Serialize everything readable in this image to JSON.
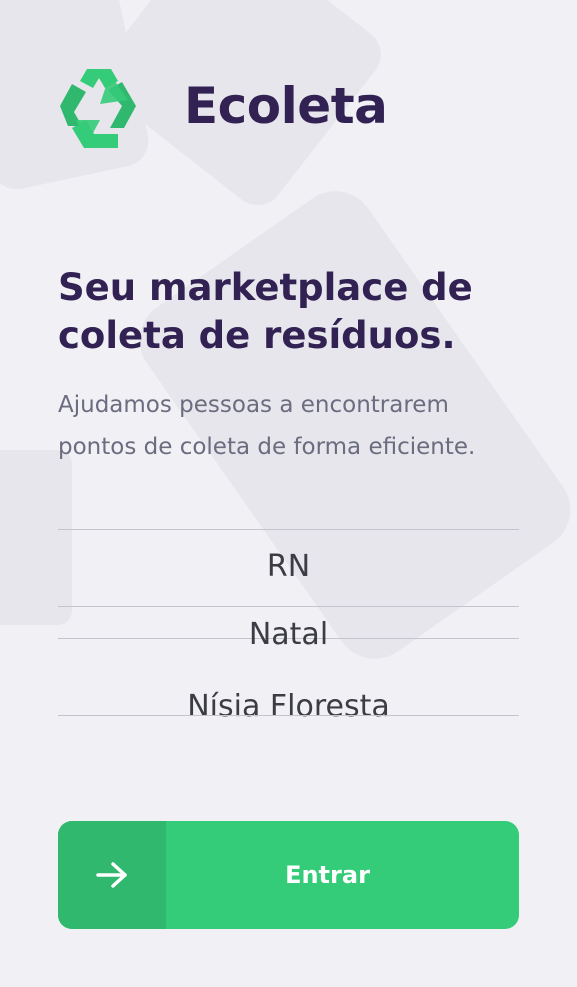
{
  "app": {
    "title": "Ecoleta",
    "logo_icon": "recycle-icon"
  },
  "hero": {
    "headline_line1": "Seu marketplace de",
    "headline_line2": "coleta de resíduos.",
    "description_line1": "Ajudamos pessoas a encontrarem",
    "description_line2": "pontos de coleta de forma eficiente."
  },
  "picker": {
    "items": [
      "RN",
      "Natal",
      "Nísia Floresta"
    ]
  },
  "enter_button": {
    "label": "Entrar",
    "icon": "arrow-right-icon"
  },
  "colors": {
    "primary": "#34cb79",
    "primary_dark": "#2fb86e",
    "title": "#322153",
    "text": "#6c6c80",
    "background": "#f0f0f5"
  }
}
